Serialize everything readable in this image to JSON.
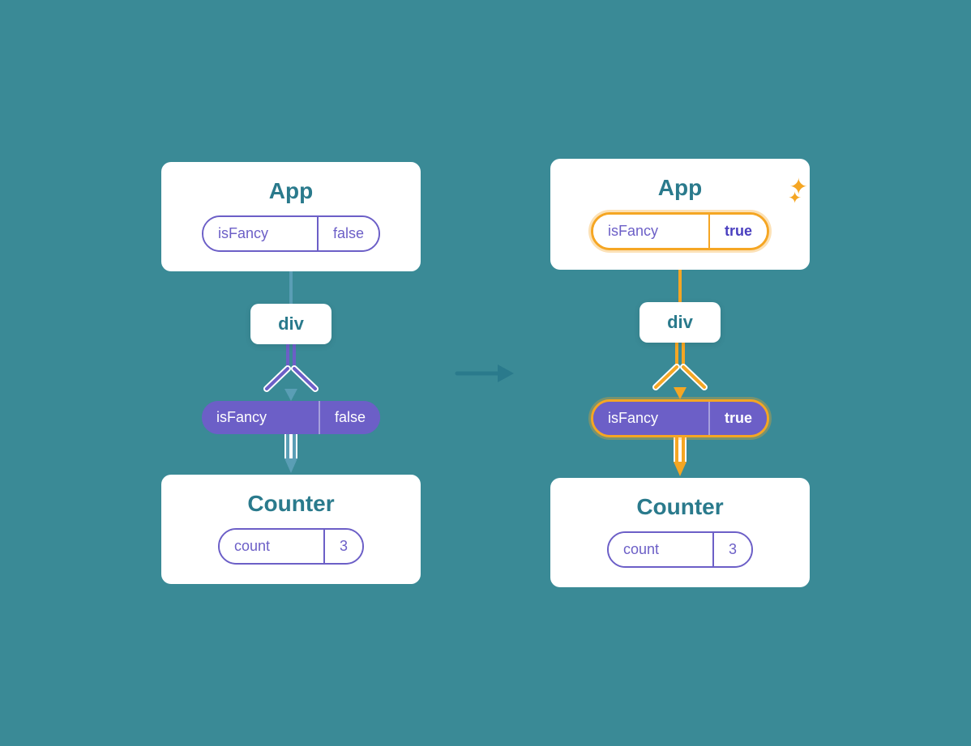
{
  "left": {
    "app": {
      "title": "App",
      "pill": {
        "label": "isFancy",
        "value": "false",
        "highlighted": false,
        "bold": false
      }
    },
    "div": {
      "label": "div"
    },
    "component": {
      "label": "isFancy",
      "value": "false",
      "highlighted": false
    },
    "counter": {
      "title": "Counter",
      "count_label": "count",
      "count_value": "3"
    }
  },
  "right": {
    "app": {
      "title": "App",
      "pill": {
        "label": "isFancy",
        "value": "true",
        "highlighted": true,
        "bold": true
      }
    },
    "div": {
      "label": "div"
    },
    "component": {
      "label": "isFancy",
      "value": "true",
      "highlighted": true
    },
    "counter": {
      "title": "Counter",
      "count_label": "count",
      "count_value": "3"
    }
  },
  "arrow": "→"
}
